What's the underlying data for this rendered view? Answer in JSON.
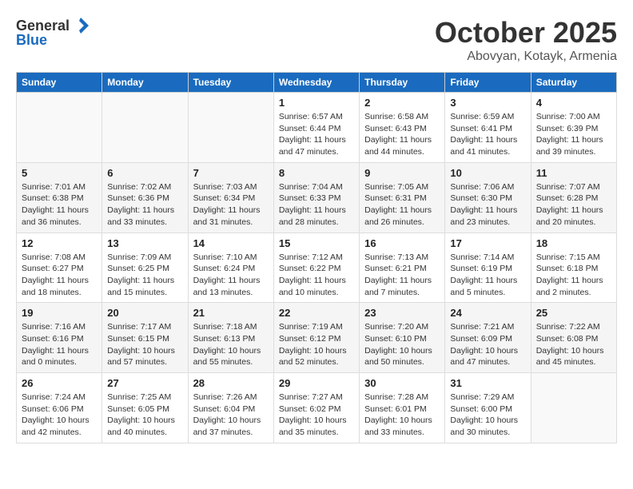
{
  "logo": {
    "general": "General",
    "blue": "Blue"
  },
  "header": {
    "title": "October 2025",
    "subtitle": "Abovyan, Kotayk, Armenia"
  },
  "weekdays": [
    "Sunday",
    "Monday",
    "Tuesday",
    "Wednesday",
    "Thursday",
    "Friday",
    "Saturday"
  ],
  "weeks": [
    [
      {
        "day": "",
        "info": ""
      },
      {
        "day": "",
        "info": ""
      },
      {
        "day": "",
        "info": ""
      },
      {
        "day": "1",
        "info": "Sunrise: 6:57 AM\nSunset: 6:44 PM\nDaylight: 11 hours\nand 47 minutes."
      },
      {
        "day": "2",
        "info": "Sunrise: 6:58 AM\nSunset: 6:43 PM\nDaylight: 11 hours\nand 44 minutes."
      },
      {
        "day": "3",
        "info": "Sunrise: 6:59 AM\nSunset: 6:41 PM\nDaylight: 11 hours\nand 41 minutes."
      },
      {
        "day": "4",
        "info": "Sunrise: 7:00 AM\nSunset: 6:39 PM\nDaylight: 11 hours\nand 39 minutes."
      }
    ],
    [
      {
        "day": "5",
        "info": "Sunrise: 7:01 AM\nSunset: 6:38 PM\nDaylight: 11 hours\nand 36 minutes."
      },
      {
        "day": "6",
        "info": "Sunrise: 7:02 AM\nSunset: 6:36 PM\nDaylight: 11 hours\nand 33 minutes."
      },
      {
        "day": "7",
        "info": "Sunrise: 7:03 AM\nSunset: 6:34 PM\nDaylight: 11 hours\nand 31 minutes."
      },
      {
        "day": "8",
        "info": "Sunrise: 7:04 AM\nSunset: 6:33 PM\nDaylight: 11 hours\nand 28 minutes."
      },
      {
        "day": "9",
        "info": "Sunrise: 7:05 AM\nSunset: 6:31 PM\nDaylight: 11 hours\nand 26 minutes."
      },
      {
        "day": "10",
        "info": "Sunrise: 7:06 AM\nSunset: 6:30 PM\nDaylight: 11 hours\nand 23 minutes."
      },
      {
        "day": "11",
        "info": "Sunrise: 7:07 AM\nSunset: 6:28 PM\nDaylight: 11 hours\nand 20 minutes."
      }
    ],
    [
      {
        "day": "12",
        "info": "Sunrise: 7:08 AM\nSunset: 6:27 PM\nDaylight: 11 hours\nand 18 minutes."
      },
      {
        "day": "13",
        "info": "Sunrise: 7:09 AM\nSunset: 6:25 PM\nDaylight: 11 hours\nand 15 minutes."
      },
      {
        "day": "14",
        "info": "Sunrise: 7:10 AM\nSunset: 6:24 PM\nDaylight: 11 hours\nand 13 minutes."
      },
      {
        "day": "15",
        "info": "Sunrise: 7:12 AM\nSunset: 6:22 PM\nDaylight: 11 hours\nand 10 minutes."
      },
      {
        "day": "16",
        "info": "Sunrise: 7:13 AM\nSunset: 6:21 PM\nDaylight: 11 hours\nand 7 minutes."
      },
      {
        "day": "17",
        "info": "Sunrise: 7:14 AM\nSunset: 6:19 PM\nDaylight: 11 hours\nand 5 minutes."
      },
      {
        "day": "18",
        "info": "Sunrise: 7:15 AM\nSunset: 6:18 PM\nDaylight: 11 hours\nand 2 minutes."
      }
    ],
    [
      {
        "day": "19",
        "info": "Sunrise: 7:16 AM\nSunset: 6:16 PM\nDaylight: 11 hours\nand 0 minutes."
      },
      {
        "day": "20",
        "info": "Sunrise: 7:17 AM\nSunset: 6:15 PM\nDaylight: 10 hours\nand 57 minutes."
      },
      {
        "day": "21",
        "info": "Sunrise: 7:18 AM\nSunset: 6:13 PM\nDaylight: 10 hours\nand 55 minutes."
      },
      {
        "day": "22",
        "info": "Sunrise: 7:19 AM\nSunset: 6:12 PM\nDaylight: 10 hours\nand 52 minutes."
      },
      {
        "day": "23",
        "info": "Sunrise: 7:20 AM\nSunset: 6:10 PM\nDaylight: 10 hours\nand 50 minutes."
      },
      {
        "day": "24",
        "info": "Sunrise: 7:21 AM\nSunset: 6:09 PM\nDaylight: 10 hours\nand 47 minutes."
      },
      {
        "day": "25",
        "info": "Sunrise: 7:22 AM\nSunset: 6:08 PM\nDaylight: 10 hours\nand 45 minutes."
      }
    ],
    [
      {
        "day": "26",
        "info": "Sunrise: 7:24 AM\nSunset: 6:06 PM\nDaylight: 10 hours\nand 42 minutes."
      },
      {
        "day": "27",
        "info": "Sunrise: 7:25 AM\nSunset: 6:05 PM\nDaylight: 10 hours\nand 40 minutes."
      },
      {
        "day": "28",
        "info": "Sunrise: 7:26 AM\nSunset: 6:04 PM\nDaylight: 10 hours\nand 37 minutes."
      },
      {
        "day": "29",
        "info": "Sunrise: 7:27 AM\nSunset: 6:02 PM\nDaylight: 10 hours\nand 35 minutes."
      },
      {
        "day": "30",
        "info": "Sunrise: 7:28 AM\nSunset: 6:01 PM\nDaylight: 10 hours\nand 33 minutes."
      },
      {
        "day": "31",
        "info": "Sunrise: 7:29 AM\nSunset: 6:00 PM\nDaylight: 10 hours\nand 30 minutes."
      },
      {
        "day": "",
        "info": ""
      }
    ]
  ]
}
